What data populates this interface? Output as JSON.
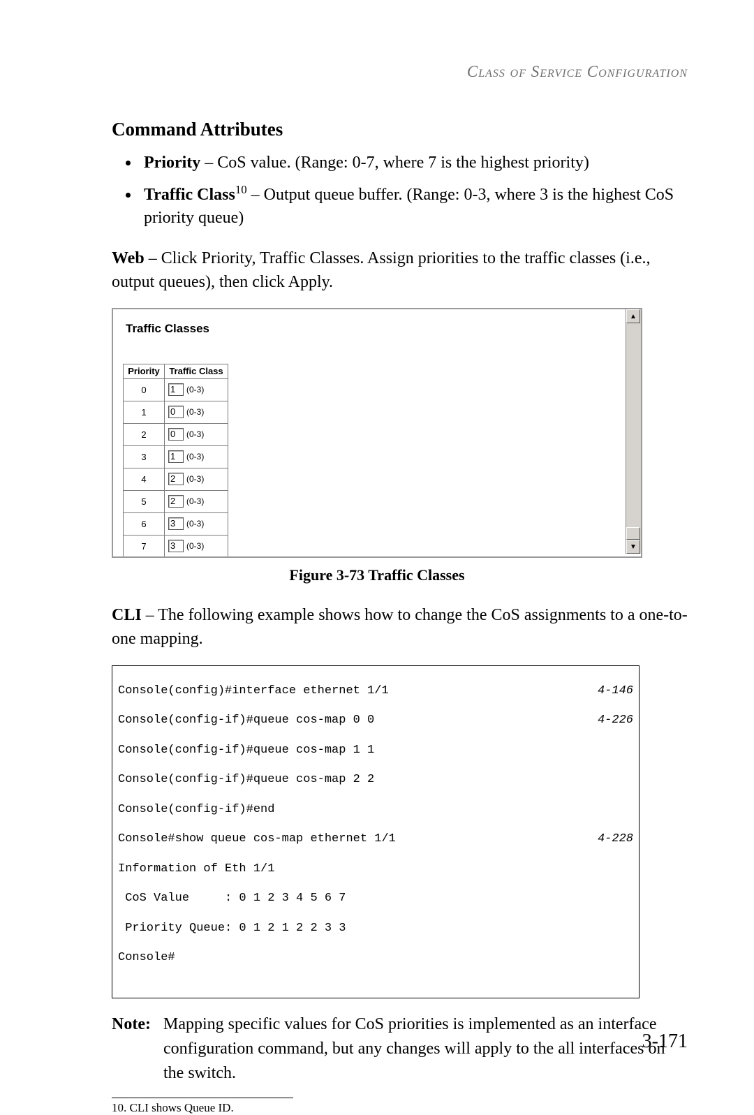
{
  "runningHead": "Class of Service Configuration",
  "sectionHead": "Command Attributes",
  "attrs": {
    "priority": {
      "name": "Priority",
      "desc": " – CoS value. (Range: 0-7, where 7 is the highest priority)"
    },
    "traffic": {
      "name": "Traffic Class",
      "sup": "10",
      "desc": " – Output queue buffer. (Range: 0-3, where 3 is the highest CoS priority queue)"
    }
  },
  "webPara": {
    "label": "Web",
    "text": " – Click Priority, Traffic Classes. Assign priorities to the traffic classes (i.e., output queues),  then click Apply."
  },
  "webshot": {
    "title": "Traffic Classes",
    "header": {
      "c1": "Priority",
      "c2": "Traffic Class"
    },
    "range": "(0-3)",
    "rows": [
      {
        "priority": "0",
        "value": "1"
      },
      {
        "priority": "1",
        "value": "0"
      },
      {
        "priority": "2",
        "value": "0"
      },
      {
        "priority": "3",
        "value": "1"
      },
      {
        "priority": "4",
        "value": "2"
      },
      {
        "priority": "5",
        "value": "2"
      },
      {
        "priority": "6",
        "value": "3"
      },
      {
        "priority": "7",
        "value": "3"
      }
    ]
  },
  "figCaption": "Figure 3-73   Traffic Classes",
  "cliPara": {
    "label": "CLI",
    "text": " – The following example shows how to change the CoS assignments to a one-to-one mapping."
  },
  "cli": {
    "lines": [
      {
        "t": "Console(config)#interface ethernet 1/1",
        "r": "4-146"
      },
      {
        "t": "Console(config-if)#queue cos-map 0 0",
        "r": "4-226"
      },
      {
        "t": "Console(config-if)#queue cos-map 1 1",
        "r": ""
      },
      {
        "t": "Console(config-if)#queue cos-map 2 2",
        "r": ""
      },
      {
        "t": "Console(config-if)#end",
        "r": ""
      },
      {
        "t": "Console#show queue cos-map ethernet 1/1",
        "r": "4-228"
      },
      {
        "t": "Information of Eth 1/1",
        "r": ""
      },
      {
        "t": " CoS Value     : 0 1 2 3 4 5 6 7",
        "r": ""
      },
      {
        "t": " Priority Queue: 0 1 2 1 2 2 3 3",
        "r": ""
      },
      {
        "t": "Console#",
        "r": ""
      }
    ]
  },
  "note": {
    "label": "Note:",
    "text": "Mapping specific values for CoS priorities is implemented as an interface configuration command, but any changes will apply to the all interfaces on the switch."
  },
  "footnote": "10.  CLI shows Queue ID.",
  "pageNumber": "3-171",
  "chart_data": {
    "type": "table",
    "title": "Traffic Classes",
    "columns": [
      "Priority",
      "Traffic Class"
    ],
    "rows": [
      [
        0,
        1
      ],
      [
        1,
        0
      ],
      [
        2,
        0
      ],
      [
        3,
        1
      ],
      [
        4,
        2
      ],
      [
        5,
        2
      ],
      [
        6,
        3
      ],
      [
        7,
        3
      ]
    ],
    "range_hint": "(0-3)"
  }
}
